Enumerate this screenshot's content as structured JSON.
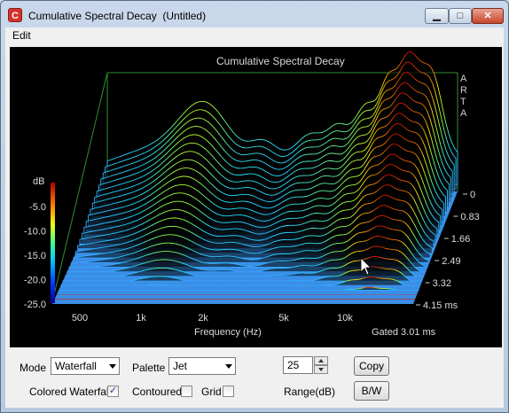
{
  "window": {
    "title": "Cumulative Spectral Decay  (Untitled)",
    "app_icon_letter": "C"
  },
  "menu": {
    "items": [
      "Edit"
    ]
  },
  "chart_data": {
    "type": "waterfall",
    "title": "Cumulative Spectral Decay",
    "xlabel": "Frequency (Hz)",
    "x_tick_labels": [
      "500",
      "1k",
      "2k",
      "5k",
      "10k"
    ],
    "y_unit": "dB",
    "y_tick_labels": [
      "-5.0",
      "-10.0",
      "-15.0",
      "-20.0",
      "-25.0"
    ],
    "ylim": [
      -25,
      0
    ],
    "z_tick_labels": [
      "0",
      "0.83",
      "1.66",
      "2.49",
      "3.32",
      "4.15 ms"
    ],
    "gated_label": "Gated 3.01 ms",
    "brand_letters": [
      "A",
      "R",
      "T",
      "A"
    ],
    "palette": "Jet",
    "x_scale": "log"
  },
  "controls": {
    "mode_label": "Mode",
    "mode_value": "Waterfall",
    "palette_label": "Palette",
    "palette_value": "Jet",
    "range_value": "25",
    "range_label": "Range(dB)",
    "copy_label": "Copy",
    "bw_label": "B/W",
    "colored_waterfall_label": "Colored Waterfall",
    "colored_waterfall_checked": "✓",
    "contoured_label": "Contoured",
    "grid_label": "Grid"
  },
  "colors": {
    "plot_background": "#000000",
    "floor": "#3a8ee6",
    "box_lines": "#2f8f2f"
  }
}
